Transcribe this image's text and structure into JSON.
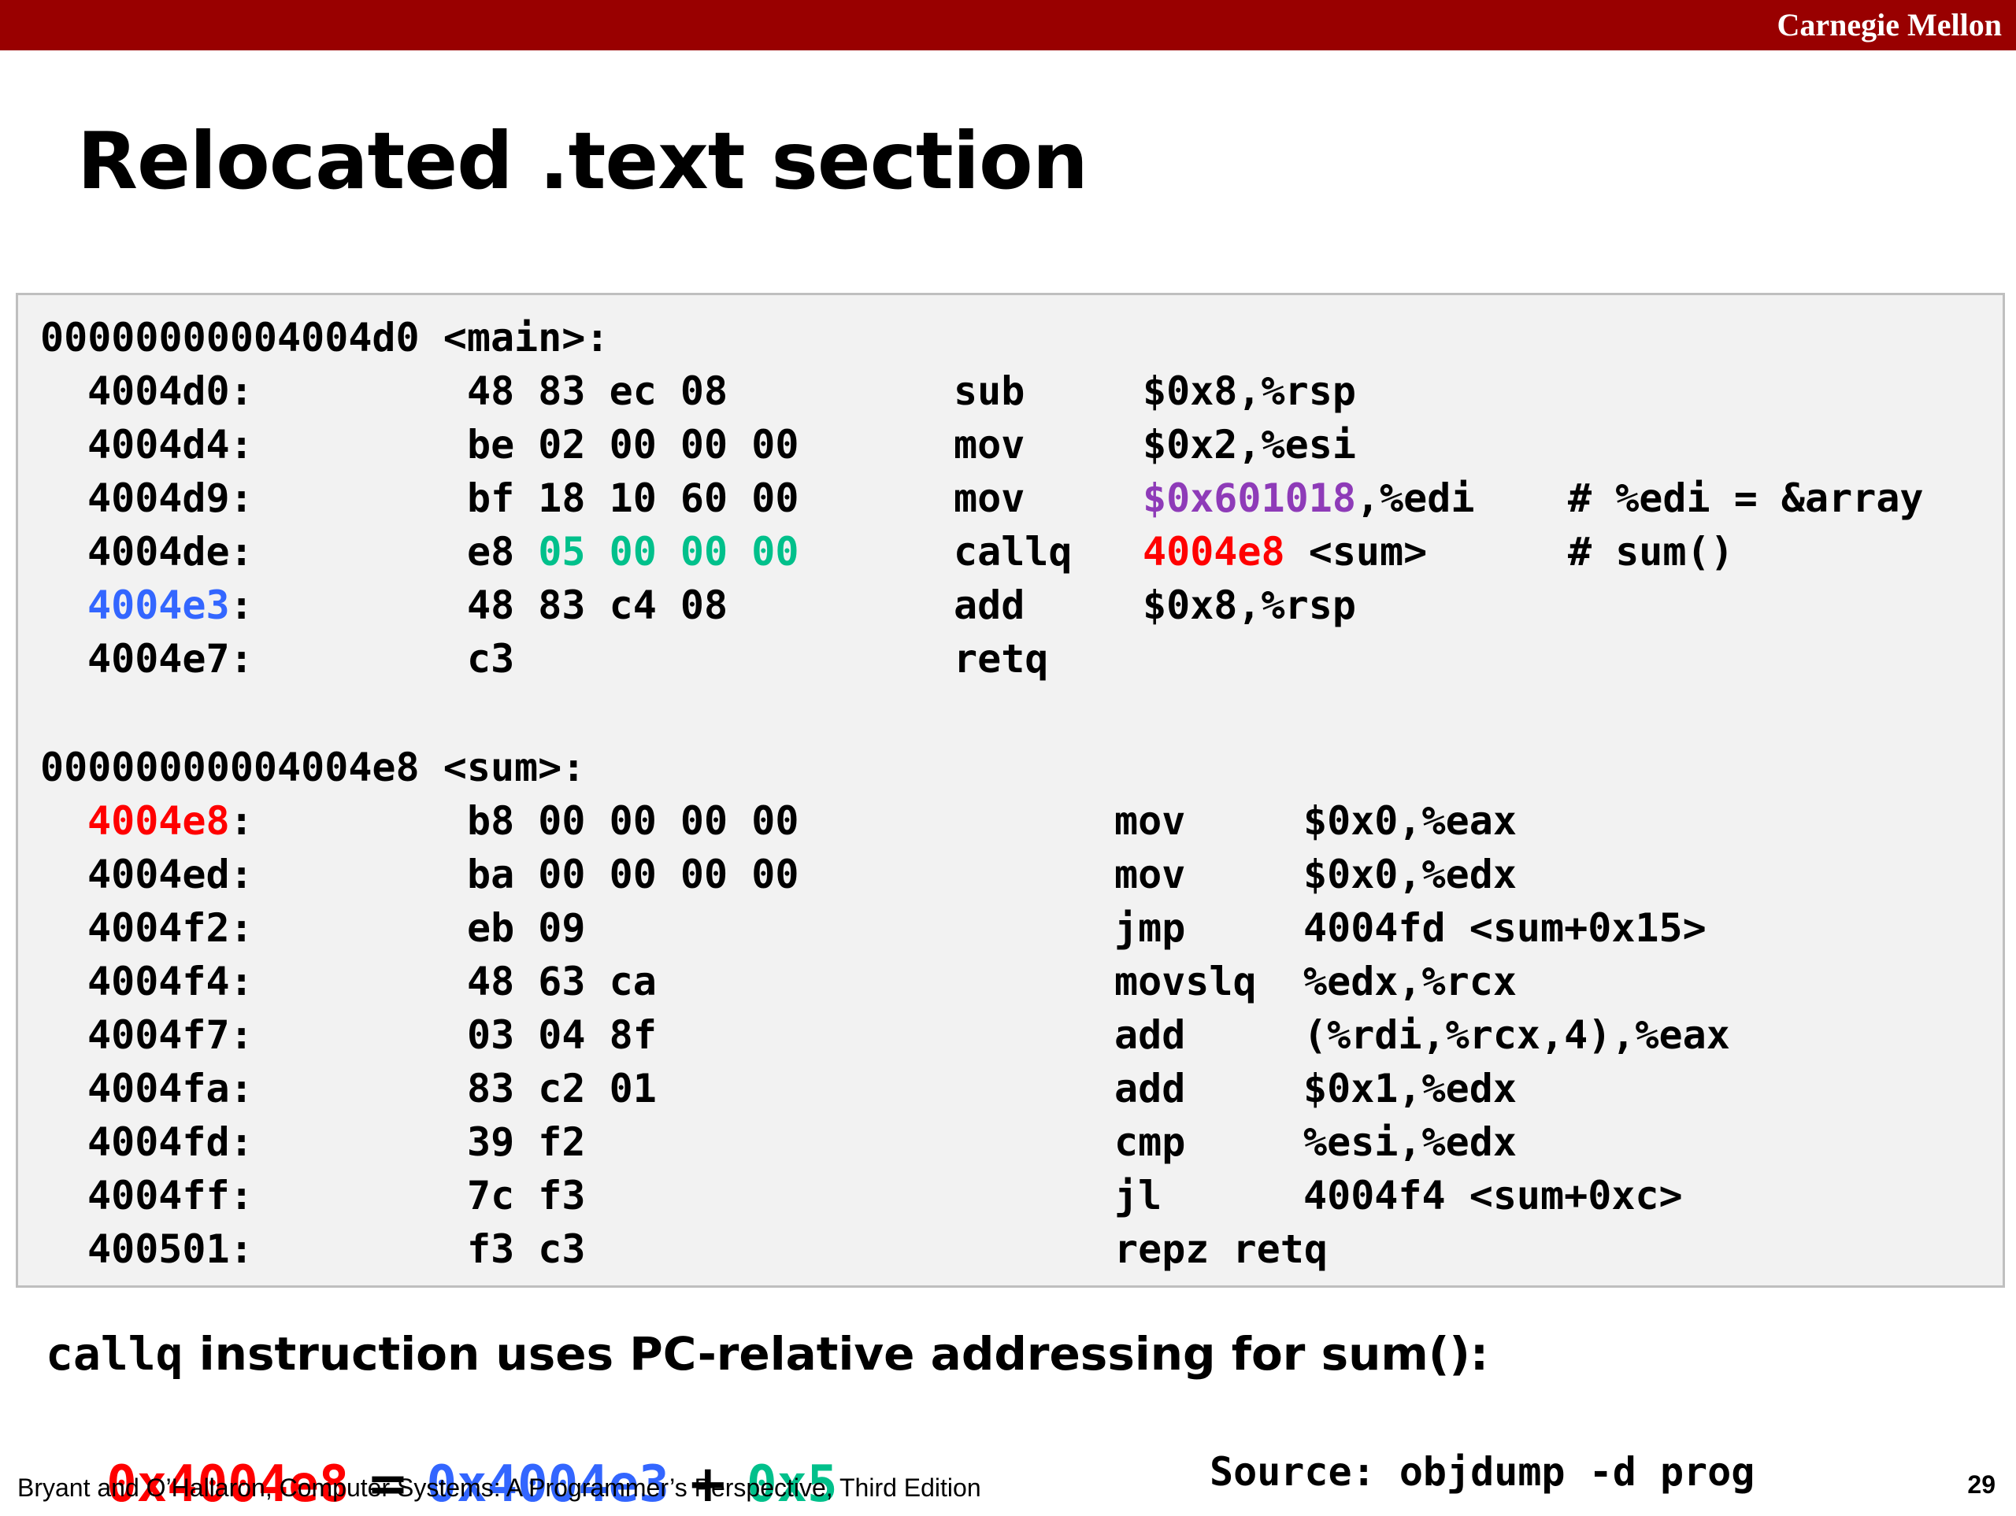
{
  "header": {
    "brand": "Carnegie Mellon"
  },
  "slide": {
    "title": "Relocated .text section",
    "page_number": "29"
  },
  "main_header": "00000000004004d0 <main>:",
  "main_rows": [
    {
      "addr": "4004d0:",
      "bytes": "48 83 ec 08",
      "op": "sub",
      "args": "$0x8,%rsp"
    },
    {
      "addr": "4004d4:",
      "bytes": "be 02 00 00 00",
      "op": "mov",
      "args": "$0x2,%esi"
    },
    {
      "addr": "4004d9:",
      "bytes": "bf 18 10 60 00",
      "op": "mov",
      "args_hl": "$0x601018",
      "args_rest": ",%edi",
      "comment": "# %edi = &array"
    },
    {
      "addr": "4004de:",
      "bytes_a": "e8 ",
      "bytes_hl": "05 00 00 00",
      "op": "callq",
      "args_hl": "4004e8",
      "args_rest": " <sum>",
      "comment": "# sum()"
    },
    {
      "addr_hl": "4004e3",
      "addr_rest": ":",
      "bytes": "48 83 c4 08",
      "op": "add",
      "args": "$0x8,%rsp"
    },
    {
      "addr": "4004e7:",
      "bytes": "c3",
      "op": "retq",
      "args": ""
    }
  ],
  "sum_header": "00000000004004e8 <sum>:",
  "sum_rows": [
    {
      "addr_hl": "4004e8",
      "addr_rest": ":",
      "bytes": "b8 00 00 00 00",
      "op": "mov",
      "args": "$0x0,%eax"
    },
    {
      "addr": "4004ed:",
      "bytes": "ba 00 00 00 00",
      "op": "mov",
      "args": "$0x0,%edx"
    },
    {
      "addr": "4004f2:",
      "bytes": "eb 09",
      "op": "jmp",
      "args": "4004fd <sum+0x15>"
    },
    {
      "addr": "4004f4:",
      "bytes": "48 63 ca",
      "op": "movslq",
      "args": "%edx,%rcx"
    },
    {
      "addr": "4004f7:",
      "bytes": "03 04 8f",
      "op": "add",
      "args": "(%rdi,%rcx,4),%eax"
    },
    {
      "addr": "4004fa:",
      "bytes": "83 c2 01",
      "op": "add",
      "args": "$0x1,%edx"
    },
    {
      "addr": "4004fd:",
      "bytes": "39 f2",
      "op": "cmp",
      "args": "%esi,%edx"
    },
    {
      "addr": "4004ff:",
      "bytes": "7c f3",
      "op": "jl",
      "args": "4004f4 <sum+0xc>"
    },
    {
      "addr": "400501:",
      "bytes": "f3 c3",
      "op": "repz retq",
      "args": ""
    }
  ],
  "caption": {
    "code": "callq",
    "text": " instruction uses PC-relative addressing for sum():"
  },
  "equation": {
    "target": "0x4004e8",
    "eq": " = ",
    "pc": "0x4004e3",
    "plus": " + ",
    "offset": "0x5"
  },
  "footer": {
    "citation": "Bryant and O’Hallaron, Computer Systems: A Programmer’s Perspective, Third Edition",
    "source": "Source: objdump -d prog"
  },
  "colors": {
    "bar": "#990000",
    "target_red": "#ff0000",
    "pc_blue": "#3366ff",
    "offset_green": "#00c08b",
    "array_purple": "#8e3bb8",
    "code_bg": "#f2f2f2"
  }
}
